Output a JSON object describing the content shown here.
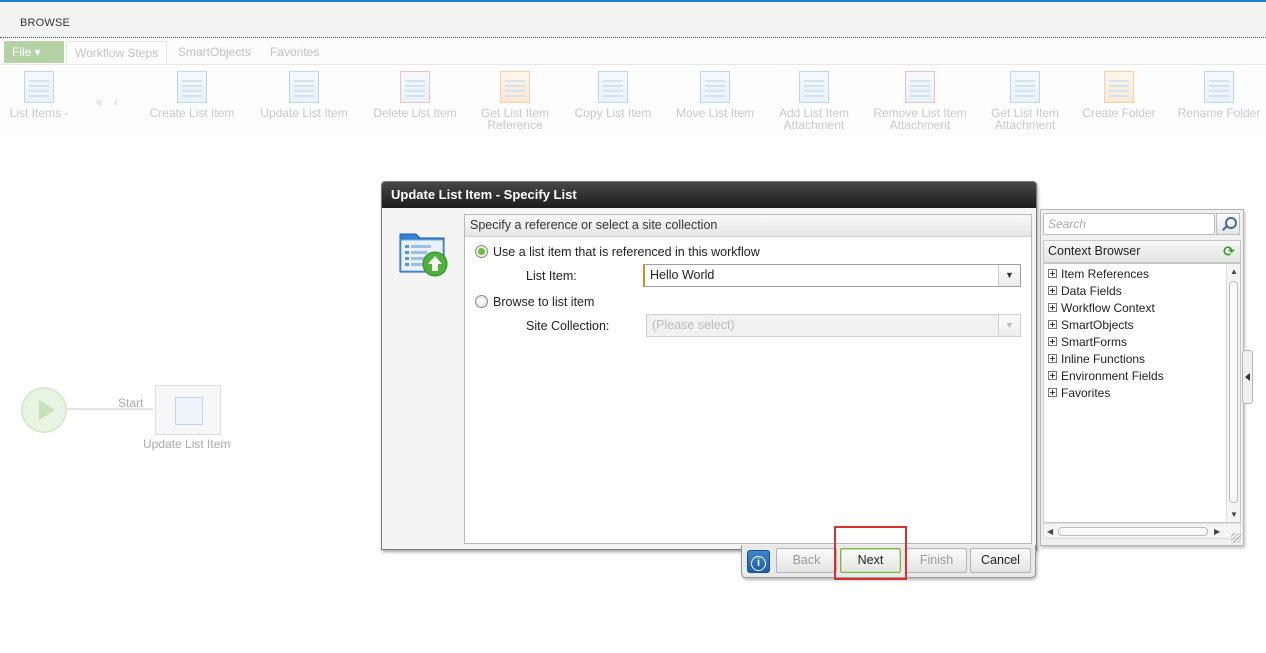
{
  "top": {
    "tab": "BROWSE"
  },
  "ribbon": {
    "file_label": "File",
    "tabs": [
      "Workflow Steps",
      "SmartObjects",
      "Favorites"
    ],
    "buttons": [
      {
        "label": "List Items",
        "icon": "list-items-icon"
      },
      {
        "label": "Create List Item",
        "icon": "create-list-item-icon"
      },
      {
        "label": "Update List Item",
        "icon": "update-list-item-icon"
      },
      {
        "label": "Delete List Item",
        "icon": "delete-list-item-icon"
      },
      {
        "label": "Get List Item Reference",
        "icon": "get-reference-icon"
      },
      {
        "label": "Copy List Item",
        "icon": "copy-list-item-icon"
      },
      {
        "label": "Move List Item",
        "icon": "move-list-item-icon"
      },
      {
        "label": "Add List Item Attachment",
        "icon": "add-attachment-icon"
      },
      {
        "label": "Remove List Item Attachment",
        "icon": "remove-attachment-icon"
      },
      {
        "label": "Get List Item Attachment",
        "icon": "get-attachment-icon"
      },
      {
        "label": "Create Folder",
        "icon": "create-folder-icon"
      },
      {
        "label": "Rename Folder",
        "icon": "rename-folder-icon"
      }
    ],
    "nav_arrows": "« ‹"
  },
  "canvas": {
    "start_label": "Start",
    "node_label": "Update List Item"
  },
  "dialog": {
    "title": "Update List Item - Specify List",
    "section_header": "Specify a reference or select a site collection",
    "option1_label": "Use a list item that is referenced in this workflow",
    "option1_selected": true,
    "list_item_label": "List Item:",
    "list_item_value": "Hello World",
    "option2_label": "Browse to list item",
    "site_collection_label": "Site Collection:",
    "site_collection_value": "(Please select)",
    "buttons": {
      "info": "i",
      "back": "Back",
      "next": "Next",
      "finish": "Finish",
      "cancel": "Cancel"
    }
  },
  "context_browser": {
    "search_placeholder": "Search",
    "title": "Context Browser",
    "items": [
      "Item References",
      "Data Fields",
      "Workflow Context",
      "SmartObjects",
      "SmartForms",
      "Inline Functions",
      "Environment Fields",
      "Favorites"
    ]
  },
  "colors": {
    "accent_blue": "#1e7fd0",
    "radio_green": "#6bbf2a",
    "highlight_red": "#d9302c",
    "title_bar": "#1c1c1c"
  }
}
